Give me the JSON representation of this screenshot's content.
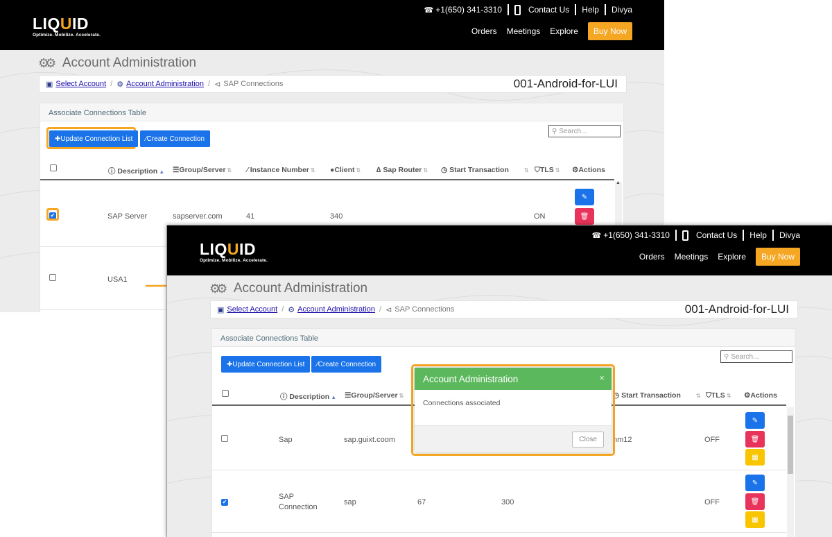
{
  "header": {
    "logo_word_pre": "LIQ",
    "logo_word_u": "U",
    "logo_word_post": "ID",
    "logo_tagline": "Optimize. Mobilize. Accelerate.",
    "phone": "+1(650) 341-3310",
    "contact": "Contact Us",
    "help": "Help",
    "user": "Divya",
    "nav": [
      "Orders",
      "Meetings",
      "Explore"
    ],
    "buy_now": "Buy Now"
  },
  "page_title": "Account Administration",
  "breadcrumb": {
    "select_account": "Select Account",
    "account_admin": "Account Administration",
    "current": "SAP Connections",
    "account_name": "001-Android-for-LUI"
  },
  "panel": {
    "heading": "Associate Connections Table",
    "update_button": "Update Connection List",
    "create_button": "Create Connection",
    "search_placeholder": "Search..."
  },
  "table_headers": {
    "description": "Description",
    "group_server": "Group/Server",
    "instance_number": "Instance Number",
    "client": "Client",
    "sap_router": "Sap Router",
    "start_transaction": "Start Transaction",
    "tls": "TLS",
    "actions": "Actions"
  },
  "back_rows": [
    {
      "description": "SAP Server",
      "server": "sapserver.com",
      "instance": "41",
      "client": "340",
      "tls": "ON"
    },
    {
      "description": "USA1"
    }
  ],
  "front_rows": [
    {
      "description": "Sap",
      "server": "sap.guixt.coom",
      "transaction": "nm12",
      "tls": "OFF"
    },
    {
      "description_line1": "SAP",
      "description_line2": "Connection",
      "server": "sap",
      "instance": "67",
      "client": "300",
      "tls": "OFF"
    }
  ],
  "modal": {
    "title": "Account Administration",
    "close_x": "×",
    "message": "Connections associated",
    "close_button": "Close",
    "header_color": "#5cb85c"
  },
  "colors": {
    "brand_orange": "#f5a623",
    "primary_blue": "#1a73e8",
    "danger_red": "#e8345a",
    "warning_yellow": "#f9c400"
  }
}
